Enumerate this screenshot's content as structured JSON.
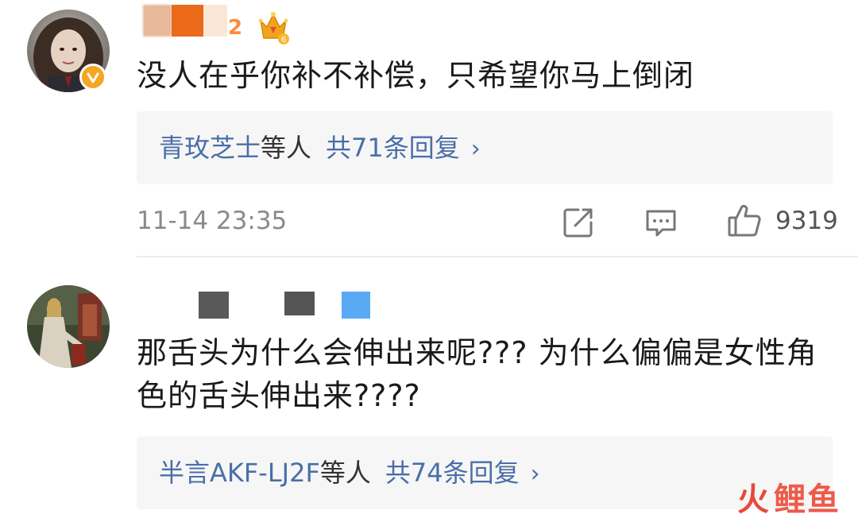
{
  "comments": [
    {
      "username_visible_fragment": "2",
      "text": "没人在乎你补不补偿，只希望你马上倒闭",
      "reply_preview": {
        "names": "青玫芝士",
        "suffix": "等人",
        "count_label": "共71条回复",
        "chevron": "›"
      },
      "timestamp": "11-14 23:35",
      "like_count": "9319",
      "badge_level": "6"
    },
    {
      "text": "那舌头为什么会伸出来呢??? 为什么偏偏是女性角色的舌头伸出来????",
      "reply_preview": {
        "names": "半言AKF-LJ2F",
        "suffix": "等人",
        "count_label": "共74条回复",
        "chevron": "›"
      }
    }
  ],
  "watermark": {
    "fire": "火",
    "text": "鲤鱼"
  },
  "icons": {
    "share": "share-icon",
    "comment": "comment-icon",
    "like": "like-icon",
    "crown": "crown-icon",
    "verified": "verified-badge-icon"
  },
  "colors": {
    "link_blue": "#4a6ea8",
    "reply_bg": "#f6f6f6",
    "meta_gray": "#8a8a8a",
    "badge_orange": "#f5a623",
    "watermark_red": "#ef5a49"
  }
}
